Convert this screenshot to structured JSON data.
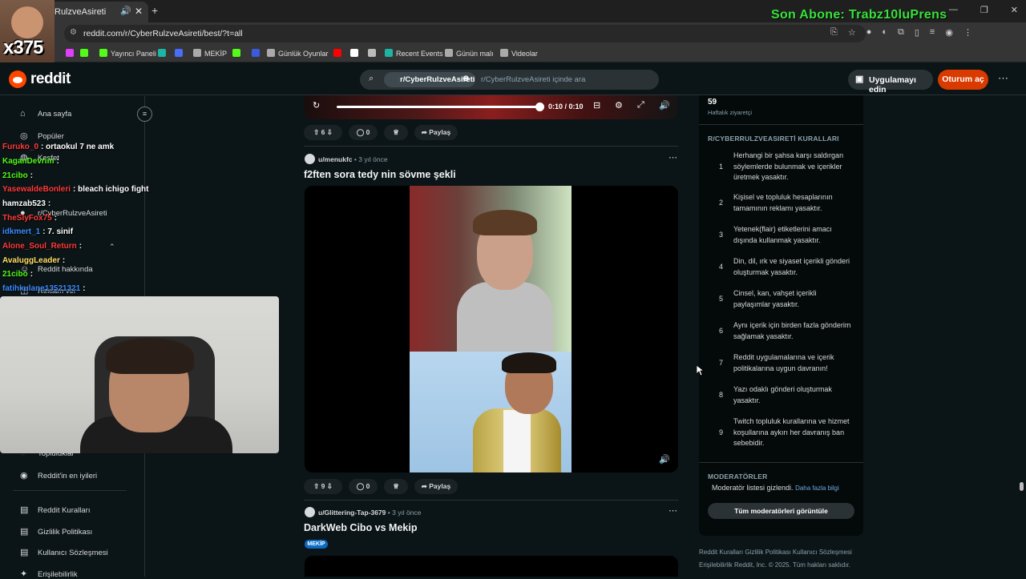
{
  "browser": {
    "tab_title": "RulzveAsireti",
    "url": "reddit.com/r/CyberRulzveAsireti/best/?t=all",
    "bookmarks": [
      {
        "label": "",
        "color": "#e040fb"
      },
      {
        "label": "",
        "color": "#53fc18"
      },
      {
        "label": "Yayıncı Paneli",
        "color": "#53fc18"
      },
      {
        "label": "",
        "color": "#1db4a3"
      },
      {
        "label": "",
        "color": "#4a6cf7"
      },
      {
        "label": "MEKİP",
        "color": "#aaaaaa"
      },
      {
        "label": "",
        "color": "#53fc18"
      },
      {
        "label": "",
        "color": "#3b5bdb"
      },
      {
        "label": "Günlük Oyunlar",
        "color": "#aaaaaa"
      },
      {
        "label": "",
        "color": "#ff0000"
      },
      {
        "label": "",
        "color": "#ffffff"
      },
      {
        "label": "",
        "color": "#bbbbbb"
      },
      {
        "label": "Recent Events",
        "color": "#1db4a3"
      },
      {
        "label": "Günün malı",
        "color": "#aaaaaa"
      },
      {
        "label": "Videolar",
        "color": "#aaaaaa"
      }
    ]
  },
  "stream_overlay": {
    "sub_label": "Son Abone: Trabz10luPrens",
    "multiplier": "x375"
  },
  "header": {
    "logo_text": "reddit",
    "search_chip": "r/CyberRulzveAsireti",
    "search_placeholder": "r/CyberRulzveAsireti içinde ara",
    "get_app": "Uygulamayı edin",
    "login": "Oturum aç"
  },
  "sidebar": {
    "items": [
      {
        "label": "Ana sayfa",
        "icon": "home-icon"
      },
      {
        "label": "Popüler",
        "icon": "popular-icon"
      },
      {
        "label": "Keşfet",
        "icon": "explore-icon"
      },
      {
        "label": "r/CyberRulzveAsireti",
        "icon": "community-icon"
      },
      {
        "label": "Reddit hakkında",
        "icon": "reddit-icon"
      },
      {
        "label": "Reklam ver",
        "icon": "ad-icon"
      },
      {
        "label": "Topluluklar",
        "icon": "communities-icon"
      },
      {
        "label": "Reddit'in en iyileri",
        "icon": "best-icon"
      },
      {
        "label": "Reddit Kuralları",
        "icon": "rules-icon"
      },
      {
        "label": "Gizlilik Politikası",
        "icon": "privacy-icon"
      },
      {
        "label": "Kullanıcı Sözleşmesi",
        "icon": "agreement-icon"
      },
      {
        "label": "Erişilebilirlik",
        "icon": "accessibility-icon"
      }
    ]
  },
  "chat": [
    {
      "user": "Furuko_0",
      "msg": ": ortaokul 7 ne amk",
      "color": "#ff3b3b"
    },
    {
      "user": "KaganDevrim",
      "msg": ":",
      "color": "#53fc18"
    },
    {
      "user": "21cibo",
      "msg": ":",
      "color": "#53fc18"
    },
    {
      "user": "YasewaldeBonleri",
      "msg": ": bleach ichigo fight",
      "color": "#ff3b3b"
    },
    {
      "user": "hamzab523",
      "msg": ":",
      "color": "#ffffff"
    },
    {
      "user": "TheSlyFox75",
      "msg": ":",
      "color": "#ff3b3b"
    },
    {
      "user": "idkmert_1",
      "msg": ": 7. sinif",
      "color": "#3b8bff"
    },
    {
      "user": "Alone_Soul_Return",
      "msg": ":",
      "color": "#ff3b3b"
    },
    {
      "user": "AvaluggLeader",
      "msg": ":",
      "color": "#ffe066"
    },
    {
      "user": "21cibo",
      "msg": ":",
      "color": "#53fc18"
    },
    {
      "user": "fatihkulane13521321",
      "msg": ":",
      "color": "#3b8bff"
    }
  ],
  "feed": {
    "video_time": "0:10 / 0:10",
    "post1_votes": "6",
    "post1_comments": "0",
    "share": "Paylaş",
    "post2": {
      "user": "u/menukfc",
      "age": "• 3 yıl önce",
      "title": "f2ften sora tedy nin sövme şekli",
      "votes": "9",
      "comments": "0"
    },
    "post3": {
      "user": "u/Glittering-Tap-3679",
      "age": "• 3 yıl önce",
      "title": "DarkWeb Cibo vs Mekip",
      "flair": "MEKİP"
    }
  },
  "right_sidebar": {
    "weekly_visitors": "59",
    "weekly_label": "Haftalık ziyaretçi",
    "rules_heading": "R/CYBERRULZVEASIRETİ KURALLARI",
    "rules": [
      {
        "n": "1",
        "text": "Herhangi bir şahsa karşı saldırgan söylemlerde bulunmak ve içerikler üretmek yasaktır."
      },
      {
        "n": "2",
        "text": "Kişisel ve topluluk hesaplarının tamamının reklamı yasaktır."
      },
      {
        "n": "3",
        "text": "Yetenek(flair) etiketlerini amacı dışında kullanmak yasaktır."
      },
      {
        "n": "4",
        "text": "Din, dil, ırk ve siyaset içerikli gönderi oluşturmak yasaktır."
      },
      {
        "n": "5",
        "text": "Cinsel, kan, vahşet içerikli paylaşımlar yasaktır."
      },
      {
        "n": "6",
        "text": "Aynı içerik için birden fazla gönderim sağlamak yasaktır."
      },
      {
        "n": "7",
        "text": "Reddit uygulamalarına ve içerik politikalarına uygun davranın!"
      },
      {
        "n": "8",
        "text": "Yazı odaklı gönderi oluşturmak yasaktır."
      },
      {
        "n": "9",
        "text": "Twitch topluluk kurallarına ve hizmet koşullarına aykırı her davranış ban sebebidir."
      }
    ],
    "mods_heading": "MODERATÖRLER",
    "mods_hidden": "Moderatör listesi gizlendi.",
    "mods_more": "Daha fazla bilgi",
    "mods_button": "Tüm moderatörleri görüntüle",
    "footer_line1": "Reddit Kuralları  Gizlilik Politikası  Kullanıcı Sözleşmesi",
    "footer_line2": "Erişilebilirlik  Reddit, Inc. © 2025. Tüm hakları saklıdır."
  }
}
